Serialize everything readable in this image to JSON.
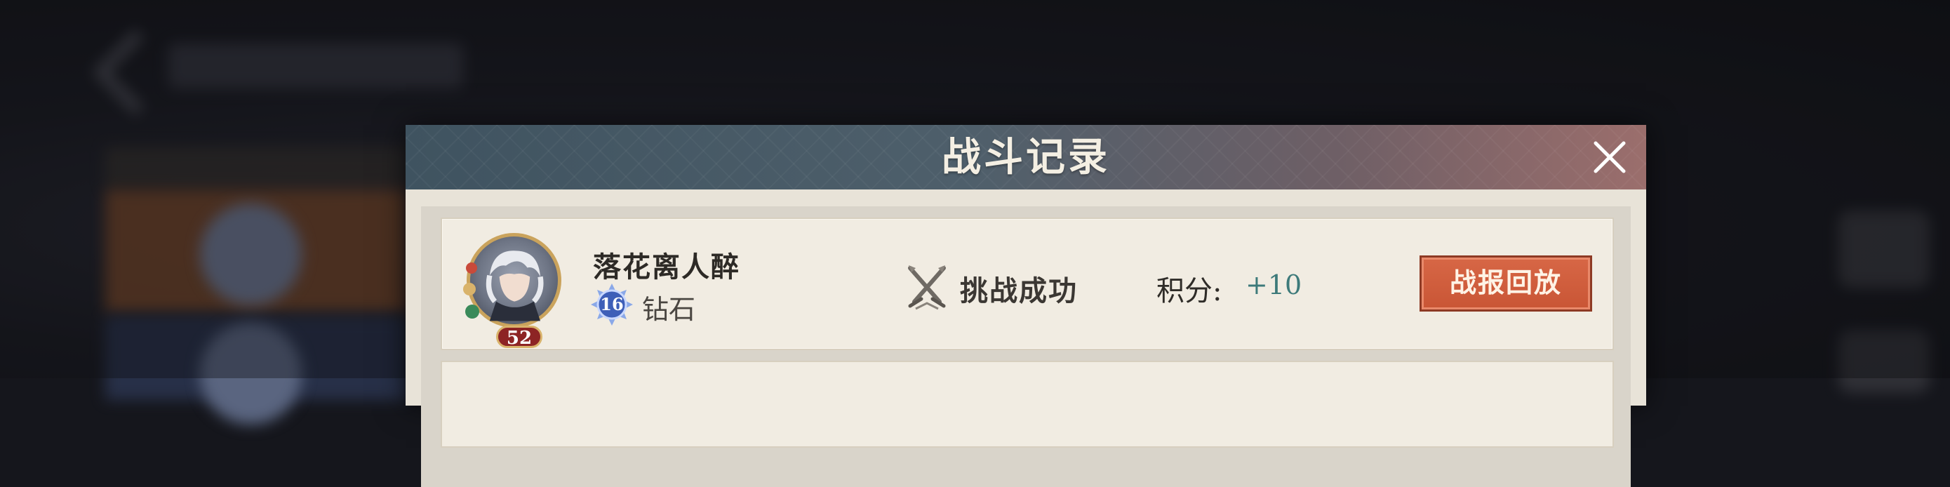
{
  "dialog": {
    "title": "战斗记录",
    "close_icon": "close-icon"
  },
  "records": [
    {
      "player_name": "落花离人醉",
      "level": "52",
      "rank_level": "16",
      "rank_name": "钻石",
      "rank_icon": "diamond-rank-icon",
      "result_icon": "crossed-swords-icon",
      "result_text": "挑战成功",
      "score_label": "积分:",
      "score_value": "+10",
      "replay_label": "战报回放"
    }
  ],
  "colors": {
    "accent_button": "#d25f3f",
    "score_value": "#3d7a7a",
    "level_badge": "#8d2424",
    "title_bar_left": "#3f5360",
    "title_bar_right": "#9b6e6c"
  }
}
